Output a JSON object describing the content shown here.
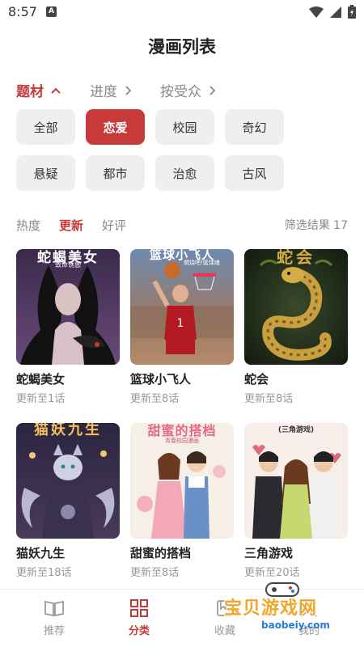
{
  "status_bar": {
    "time": "8:57",
    "notification_glyph": "A",
    "icons": [
      "wifi-icon",
      "signal-icon",
      "battery-icon"
    ]
  },
  "page": {
    "title": "漫画列表"
  },
  "filter_tabs": [
    {
      "label": "题材",
      "active": true,
      "arrow": "up"
    },
    {
      "label": "进度",
      "active": false,
      "arrow": "right"
    },
    {
      "label": "按受众",
      "active": false,
      "arrow": "right"
    }
  ],
  "genres": [
    {
      "label": "全部",
      "selected": false
    },
    {
      "label": "恋爱",
      "selected": true
    },
    {
      "label": "校园",
      "selected": false
    },
    {
      "label": "奇幻",
      "selected": false
    },
    {
      "label": "悬疑",
      "selected": false
    },
    {
      "label": "都市",
      "selected": false
    },
    {
      "label": "治愈",
      "selected": false
    },
    {
      "label": "古风",
      "selected": false
    }
  ],
  "sort": {
    "tabs": [
      {
        "label": "热度",
        "active": false
      },
      {
        "label": "更新",
        "active": true
      },
      {
        "label": "好评",
        "active": false
      }
    ],
    "result_label": "筛选结果 17"
  },
  "comics": [
    {
      "title": "蛇蝎美女",
      "status": "更新至1话",
      "cover_text": "蛇蝎美女",
      "cover_subtitle": "致命诱惑"
    },
    {
      "title": "篮球小飞人",
      "status": "更新至8话",
      "cover_text": "篮球小飞人",
      "cover_subtitle": "燃烧吧!篮球魂"
    },
    {
      "title": "蛇会",
      "status": "更新至8话",
      "cover_text": "蛇会",
      "cover_subtitle": ""
    },
    {
      "title": "猫妖九生",
      "status": "更新至18话",
      "cover_text": "猫妖九生",
      "cover_subtitle": ""
    },
    {
      "title": "甜蜜的搭档",
      "status": "更新至8话",
      "cover_text": "甜蜜的搭档",
      "cover_subtitle": "青春校园漫画"
    },
    {
      "title": "三角游戏",
      "status": "更新至20话",
      "cover_text": "三角游戏",
      "cover_subtitle": "(三角游戏)"
    }
  ],
  "bottom_nav": [
    {
      "label": "推荐",
      "icon": "book-icon",
      "active": false
    },
    {
      "label": "分类",
      "icon": "grid-icon",
      "active": true
    },
    {
      "label": "收藏",
      "icon": "bookmark-icon",
      "active": false
    },
    {
      "label": "我的",
      "icon": "user-icon",
      "active": false
    }
  ],
  "watermark": {
    "text": "宝贝游戏网",
    "url": "baobeiy.com"
  },
  "colors": {
    "accent": "#c63a3a",
    "chip_bg": "#efefef",
    "muted_text": "#888888"
  }
}
